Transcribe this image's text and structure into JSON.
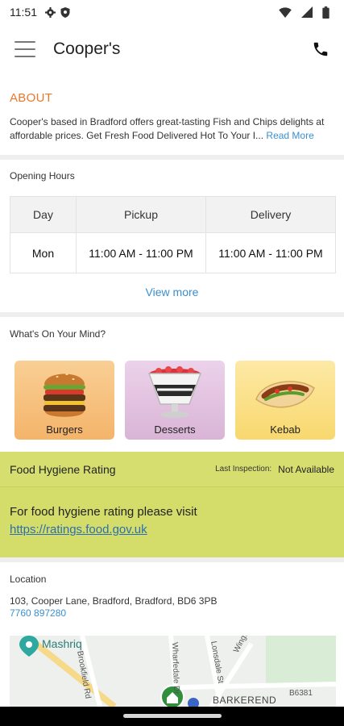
{
  "status_bar": {
    "time": "11:51"
  },
  "app_bar": {
    "title": "Cooper's"
  },
  "about": {
    "heading": "ABOUT",
    "text": "Cooper's based in Bradford offers great-tasting Fish and Chips delights at affordable prices. Get Fresh Food Delivered Hot To Your I...",
    "read_more": "Read More"
  },
  "opening_hours": {
    "title": "Opening Hours",
    "headers": [
      "Day",
      "Pickup",
      "Delivery"
    ],
    "rows": [
      {
        "day": "Mon",
        "pickup": "11:00 AM - 11:00 PM",
        "delivery": "11:00 AM - 11:00 PM"
      }
    ],
    "view_more": "View more"
  },
  "mind": {
    "title": "What's On Your Mind?",
    "categories": [
      {
        "label": "Burgers"
      },
      {
        "label": "Desserts"
      },
      {
        "label": "Kebab"
      }
    ]
  },
  "hygiene": {
    "title": "Food Hygiene Rating",
    "last_inspection_label": "Last Inspection:",
    "last_inspection_value": "Not Available",
    "body_text": "For food hygiene rating please visit",
    "link": "https://ratings.food.gov.uk"
  },
  "location": {
    "title": "Location",
    "address": "103, Cooper Lane, Bradford, Bradford, BD6 3PB",
    "phone": "7760 897280"
  },
  "map": {
    "labels": [
      "Mashriq",
      "Brookfield Rd",
      "Wharfedale Dr",
      "Lonsdale St",
      "Wingfield St",
      "BARKEREND",
      "B6381"
    ]
  },
  "colors": {
    "accent": "#e8782e",
    "link": "#3a8fcf",
    "hygiene_bg": "#d4dc6a"
  }
}
